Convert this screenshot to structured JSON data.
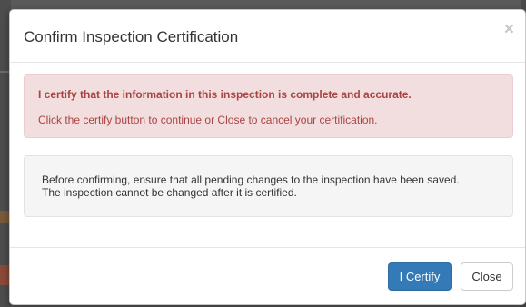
{
  "modal": {
    "title": "Confirm Inspection Certification",
    "close_glyph": "×"
  },
  "alert": {
    "heading": "I certify that the information in this inspection is complete and accurate.",
    "message": "Click the certify button to continue or Close to cancel your certification."
  },
  "notice": {
    "line1": "Before confirming, ensure that all pending changes to the inspection have been saved.",
    "line2": "The inspection cannot be changed after it is certified."
  },
  "footer": {
    "certify_label": "I Certify",
    "close_label": "Close"
  },
  "colors": {
    "primary": "#337ab7",
    "danger_text": "#a94442",
    "danger_bg": "#f2dede",
    "well_bg": "#f5f5f5"
  }
}
